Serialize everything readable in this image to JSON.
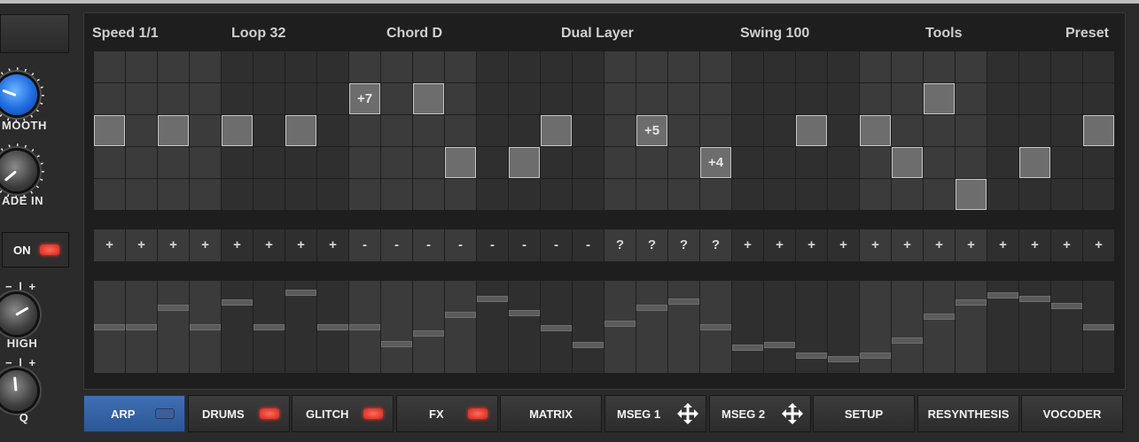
{
  "left_panel": {
    "knobs": [
      {
        "label": "MOOTH",
        "style": "blue"
      },
      {
        "label": "ADE IN",
        "style": "grey"
      },
      {
        "label": "HIGH",
        "style": "grey",
        "scale": "−  |  +"
      },
      {
        "label": "Q",
        "style": "grey",
        "scale": "−  |  +"
      }
    ],
    "on_toggle": {
      "label": "ON",
      "led_color": "#e8362a"
    }
  },
  "header": {
    "items": [
      "Speed 1/1",
      "Loop 32",
      "Chord D",
      "Dual Layer",
      "Swing 100",
      "Tools",
      "Preset"
    ]
  },
  "sequencer": {
    "steps": 32,
    "rows": 5,
    "notes": [
      {
        "step": 0,
        "row": 2,
        "label": ""
      },
      {
        "step": 2,
        "row": 2,
        "label": ""
      },
      {
        "step": 4,
        "row": 2,
        "label": ""
      },
      {
        "step": 6,
        "row": 2,
        "label": ""
      },
      {
        "step": 8,
        "row": 1,
        "label": "+7"
      },
      {
        "step": 10,
        "row": 1,
        "label": ""
      },
      {
        "step": 11,
        "row": 3,
        "label": ""
      },
      {
        "step": 13,
        "row": 3,
        "label": ""
      },
      {
        "step": 14,
        "row": 2,
        "label": ""
      },
      {
        "step": 17,
        "row": 2,
        "label": "+5"
      },
      {
        "step": 19,
        "row": 3,
        "label": "+4"
      },
      {
        "step": 22,
        "row": 2,
        "label": ""
      },
      {
        "step": 24,
        "row": 2,
        "label": ""
      },
      {
        "step": 25,
        "row": 3,
        "label": ""
      },
      {
        "step": 26,
        "row": 1,
        "label": ""
      },
      {
        "step": 27,
        "row": 4,
        "label": ""
      },
      {
        "step": 29,
        "row": 3,
        "label": ""
      },
      {
        "step": 31,
        "row": 2,
        "label": ""
      }
    ],
    "operations": [
      "+",
      "+",
      "+",
      "+",
      "+",
      "+",
      "+",
      "+",
      "-",
      "-",
      "-",
      "-",
      "-",
      "-",
      "-",
      "-",
      "?",
      "?",
      "?",
      "?",
      "+",
      "+",
      "+",
      "+",
      "+",
      "+",
      "+",
      "+",
      "+",
      "+",
      "+",
      "+"
    ],
    "velocities": [
      0.5,
      0.5,
      0.72,
      0.5,
      0.78,
      0.5,
      0.9,
      0.5,
      0.5,
      0.3,
      0.42,
      0.64,
      0.82,
      0.66,
      0.48,
      0.29,
      0.54,
      0.72,
      0.79,
      0.5,
      0.26,
      0.29,
      0.17,
      0.12,
      0.17,
      0.34,
      0.62,
      0.78,
      0.87,
      0.82,
      0.74,
      0.5
    ]
  },
  "tabs": [
    {
      "label": "ARP",
      "active": true,
      "indicator": "led-blue"
    },
    {
      "label": "DRUMS",
      "active": false,
      "indicator": "led-red"
    },
    {
      "label": "GLITCH",
      "active": false,
      "indicator": "led-red"
    },
    {
      "label": "FX",
      "active": false,
      "indicator": "led-red"
    },
    {
      "label": "MATRIX",
      "active": false,
      "indicator": "none"
    },
    {
      "label": "MSEG 1",
      "active": false,
      "indicator": "move-icon"
    },
    {
      "label": "MSEG 2",
      "active": false,
      "indicator": "move-icon"
    },
    {
      "label": "SETUP",
      "active": false,
      "indicator": "none"
    },
    {
      "label": "RESYNTHESIS",
      "active": false,
      "indicator": "none"
    },
    {
      "label": "VOCODER",
      "active": false,
      "indicator": "none"
    }
  ],
  "colors": {
    "accent_blue": "#2b5795",
    "led_red": "#e8362a",
    "note_fill": "#6d6d6d",
    "cell_light": "#3b3b3b",
    "cell_dark": "#2f2f2f"
  }
}
